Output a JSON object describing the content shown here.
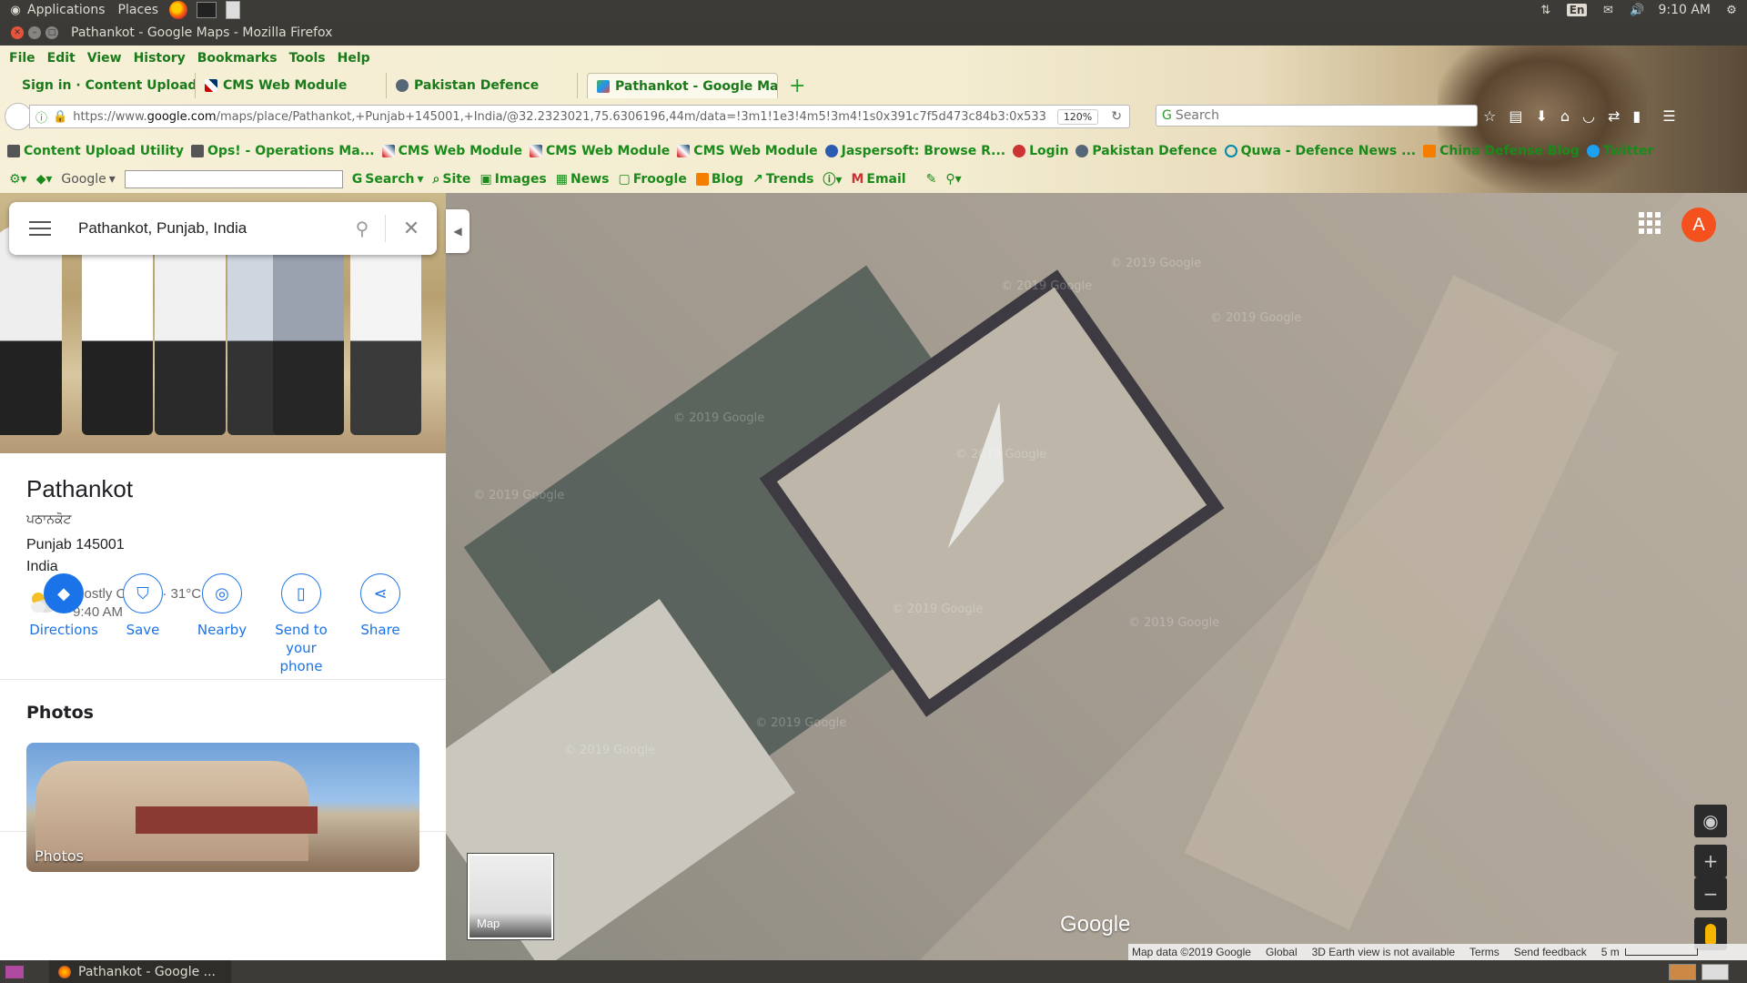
{
  "top_panel": {
    "applications": "Applications",
    "places": "Places",
    "lang": "En",
    "clock": "9:10 AM"
  },
  "window": {
    "title": "Pathankot - Google Maps - Mozilla Firefox"
  },
  "menu": [
    "File",
    "Edit",
    "View",
    "History",
    "Bookmarks",
    "Tools",
    "Help"
  ],
  "tabs": [
    {
      "label": "Sign in · Content Upload U",
      "active": false
    },
    {
      "label": "CMS Web Module",
      "active": false
    },
    {
      "label": "Pakistan Defence",
      "active": false
    },
    {
      "label": "Pathankot - Google Ma",
      "active": true
    }
  ],
  "nav": {
    "url_prefix": "https://www.",
    "url_domain": "google.com",
    "url_rest": "/maps/place/Pathankot,+Punjab+145001,+India/@32.2323021,75.6306196,44m/data=!3m1!1e3!4m5!3m4!1s0x391c7f5d473c84b3:0x533",
    "zoom": "120%",
    "search_placeholder": "Search"
  },
  "bookmarks": [
    "Content Upload Utility",
    "Ops! - Operations Ma...",
    "CMS Web Module",
    "CMS Web Module",
    "CMS Web Module",
    "Jaspersoft: Browse R...",
    "Login",
    "Pakistan Defence",
    "Quwa - Defence News ...",
    "China Defense Blog",
    "Twitter"
  ],
  "google_toolbar": {
    "brand": "Google",
    "items": [
      "Search",
      "Site",
      "Images",
      "News",
      "Froogle",
      "Blog",
      "Trends",
      "Email"
    ]
  },
  "maps": {
    "search_value": "Pathankot, Punjab, India",
    "place": {
      "title": "Pathankot",
      "native_name": "ਪਠਾਨਕੋਟ",
      "address_line1": "Punjab 145001",
      "address_line2": "India",
      "weather": "Mostly Cloudy · 31°C",
      "weather_time": "9:40 AM"
    },
    "actions": [
      {
        "label": "Directions",
        "icon": "directions-icon"
      },
      {
        "label": "Save",
        "icon": "bookmark-icon"
      },
      {
        "label": "Nearby",
        "icon": "nearby-icon"
      },
      {
        "label": "Send to your phone",
        "icon": "send-to-phone-icon"
      },
      {
        "label": "Share",
        "icon": "share-icon"
      }
    ],
    "photos_title": "Photos",
    "photos_label": "Photos",
    "avatar_letter": "A",
    "map_toggle_label": "Map",
    "logo": "Google",
    "watermark": "© 2019 Google",
    "footer": {
      "map_data": "Map data ©2019 Google",
      "global": "Global",
      "earth_view": "3D Earth view is not available",
      "terms": "Terms",
      "feedback": "Send feedback",
      "scale": "5 m"
    }
  },
  "taskbar": {
    "window_label": "Pathankot - Google ..."
  },
  "colors": {
    "accent": "#1a73e8",
    "avatar": "#f4511e",
    "bookmark_text": "#1a8a1a"
  }
}
